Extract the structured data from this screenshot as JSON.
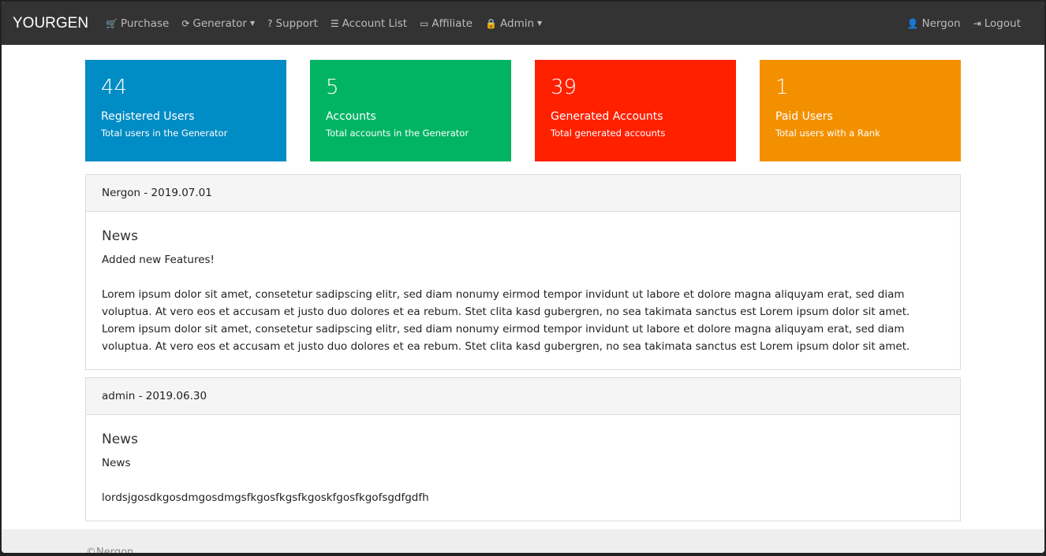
{
  "nav": {
    "brand": "YOURGEN",
    "items": [
      {
        "label": "Purchase",
        "icon": "cart-icon",
        "glyph": "🛒"
      },
      {
        "label": "Generator",
        "icon": "refresh-icon",
        "glyph": "⟳",
        "dropdown": true
      },
      {
        "label": "Support",
        "icon": "question-icon",
        "glyph": "?"
      },
      {
        "label": "Account List",
        "icon": "list-icon",
        "glyph": "☰"
      },
      {
        "label": "Affiliate",
        "icon": "money-icon",
        "glyph": "▭"
      },
      {
        "label": "Admin",
        "icon": "lock-icon",
        "glyph": "🔒",
        "dropdown": true
      }
    ],
    "user": "Nergon",
    "logout": "Logout"
  },
  "stats": [
    {
      "value": "44",
      "title": "Registered Users",
      "sub": "Total users in the Generator",
      "color": "#008cc4"
    },
    {
      "value": "5",
      "title": "Accounts",
      "sub": "Total accounts in the Generator",
      "color": "#00b464"
    },
    {
      "value": "39",
      "title": "Generated Accounts",
      "sub": "Total generated accounts",
      "color": "#ff2000"
    },
    {
      "value": "1",
      "title": "Paid Users",
      "sub": "Total users with a Rank",
      "color": "#f39000"
    }
  ],
  "news": [
    {
      "header": "Nergon - 2019.07.01",
      "title": "News",
      "paragraphs": [
        "Added new Features!",
        "Lorem ipsum dolor sit amet, consetetur sadipscing elitr, sed diam nonumy eirmod tempor invidunt ut labore et dolore magna aliquyam erat, sed diam voluptua. At vero eos et accusam et justo duo dolores et ea rebum. Stet clita kasd gubergren, no sea takimata sanctus est Lorem ipsum dolor sit amet. Lorem ipsum dolor sit amet, consetetur sadipscing elitr, sed diam nonumy eirmod tempor invidunt ut labore et dolore magna aliquyam erat, sed diam voluptua. At vero eos et accusam et justo duo dolores et ea rebum. Stet clita kasd gubergren, no sea takimata sanctus est Lorem ipsum dolor sit amet."
      ]
    },
    {
      "header": "admin - 2019.06.30",
      "title": "News",
      "paragraphs": [
        "News",
        "lordsjgosdkgosdmgosdmgsfkgosfkgsfkgoskfgosfkgofsgdfgdfh"
      ]
    }
  ],
  "footer": "©Nergon"
}
